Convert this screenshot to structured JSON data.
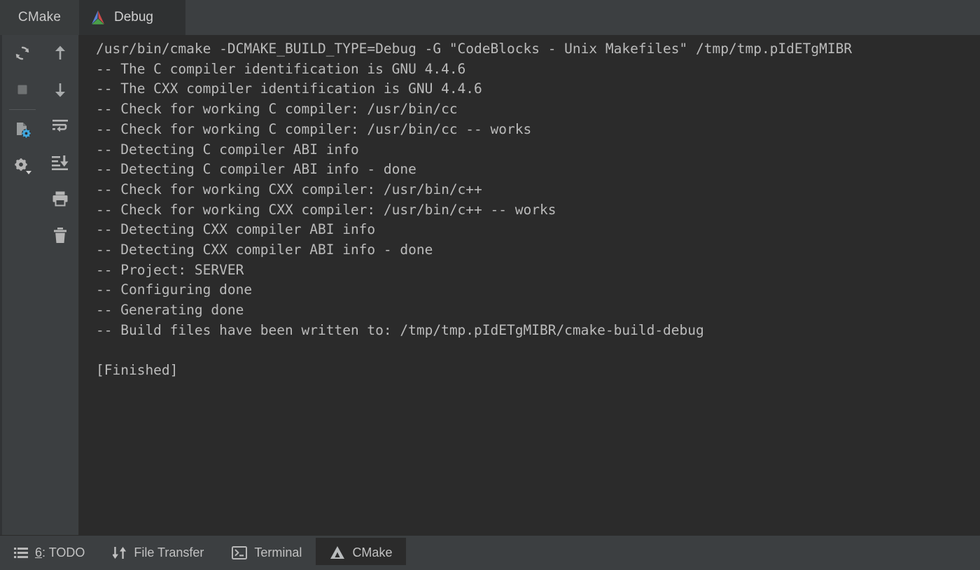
{
  "window": {
    "background_color": "#3c3f41",
    "console_background_color": "#2b2b2b",
    "console_text_color": "#bbbbbb",
    "accent_blue": "#3592c4"
  },
  "tabstrip": {
    "panel_title": "CMake",
    "tabs": [
      {
        "label": "Debug",
        "icon": "cmake-logo-icon",
        "active": true
      }
    ]
  },
  "toolbar": {
    "left_column": [
      {
        "name": "rerun-cmake-button",
        "icon": "rerun-icon",
        "tooltip": "Rerun CMake"
      },
      {
        "name": "stop-button",
        "icon": "stop-square-icon",
        "tooltip": "Stop"
      },
      {
        "name": "toolbar-separator",
        "icon": "separator"
      },
      {
        "name": "cmake-settings-file-button",
        "icon": "file-gear-icon",
        "tooltip": "CMake Settings"
      },
      {
        "name": "settings-button",
        "icon": "gear-dropdown-icon",
        "tooltip": "Settings"
      }
    ],
    "right_column": [
      {
        "name": "previous-occurrence-button",
        "icon": "arrow-up-icon",
        "tooltip": "Up"
      },
      {
        "name": "next-occurrence-button",
        "icon": "arrow-down-icon",
        "tooltip": "Down"
      },
      {
        "name": "soft-wrap-button",
        "icon": "soft-wrap-icon",
        "tooltip": "Soft-Wrap"
      },
      {
        "name": "scroll-to-end-button",
        "icon": "scroll-to-end-icon",
        "tooltip": "Scroll to the end"
      },
      {
        "name": "print-button",
        "icon": "printer-icon",
        "tooltip": "Print"
      },
      {
        "name": "clear-all-button",
        "icon": "trash-icon",
        "tooltip": "Clear All"
      }
    ]
  },
  "console": {
    "output": "/usr/bin/cmake -DCMAKE_BUILD_TYPE=Debug -G \"CodeBlocks - Unix Makefiles\" /tmp/tmp.pIdETgMIBR\n-- The C compiler identification is GNU 4.4.6\n-- The CXX compiler identification is GNU 4.4.6\n-- Check for working C compiler: /usr/bin/cc\n-- Check for working C compiler: /usr/bin/cc -- works\n-- Detecting C compiler ABI info\n-- Detecting C compiler ABI info - done\n-- Check for working CXX compiler: /usr/bin/c++\n-- Check for working CXX compiler: /usr/bin/c++ -- works\n-- Detecting CXX compiler ABI info\n-- Detecting CXX compiler ABI info - done\n-- Project: SERVER\n-- Configuring done\n-- Generating done\n-- Build files have been written to: /tmp/tmp.pIdETgMIBR/cmake-build-debug\n\n[Finished]"
  },
  "statusbar": {
    "items": [
      {
        "name": "sidebar-item-todo",
        "icon": "list-icon",
        "number": "6",
        "label": ": TODO",
        "active": false
      },
      {
        "name": "sidebar-item-file-transfer",
        "icon": "transfer-arrows-icon",
        "label": "File Transfer",
        "active": false
      },
      {
        "name": "sidebar-item-terminal",
        "icon": "terminal-icon",
        "label": "Terminal",
        "active": false
      },
      {
        "name": "sidebar-item-cmake",
        "icon": "cmake-triangle-icon",
        "label": "CMake",
        "active": true
      }
    ]
  }
}
